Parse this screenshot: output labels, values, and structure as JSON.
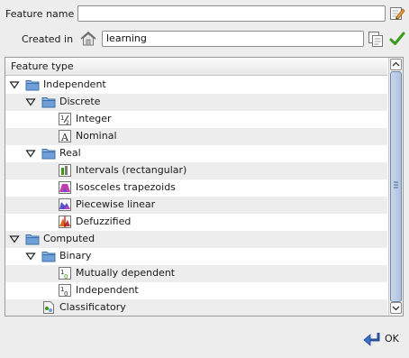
{
  "form": {
    "feature_name_label": "Feature name",
    "feature_name_value": "",
    "created_in_label": "Created in",
    "created_in_value": "learning"
  },
  "tree": {
    "column_header": "Feature type",
    "rows": [
      {
        "label": "Independent",
        "depth": 0,
        "expander": "expanded",
        "icon": "folder-icon"
      },
      {
        "label": "Discrete",
        "depth": 1,
        "expander": "expanded",
        "icon": "folder-icon"
      },
      {
        "label": "Integer",
        "depth": 2,
        "expander": "none",
        "icon": "integer-icon"
      },
      {
        "label": "Nominal",
        "depth": 2,
        "expander": "none",
        "icon": "nominal-icon"
      },
      {
        "label": "Real",
        "depth": 1,
        "expander": "expanded",
        "icon": "folder-icon"
      },
      {
        "label": "Intervals (rectangular)",
        "depth": 2,
        "expander": "none",
        "icon": "intervals-icon"
      },
      {
        "label": "Isosceles trapezoids",
        "depth": 2,
        "expander": "none",
        "icon": "trapezoid-icon"
      },
      {
        "label": "Piecewise linear",
        "depth": 2,
        "expander": "none",
        "icon": "piecewise-icon"
      },
      {
        "label": "Defuzzified",
        "depth": 2,
        "expander": "none",
        "icon": "defuzzified-icon"
      },
      {
        "label": "Computed",
        "depth": 0,
        "expander": "expanded",
        "icon": "folder-icon"
      },
      {
        "label": "Binary",
        "depth": 1,
        "expander": "expanded",
        "icon": "folder-icon"
      },
      {
        "label": "Mutually dependent",
        "depth": 2,
        "expander": "none",
        "icon": "binary-dependent-icon"
      },
      {
        "label": "Independent",
        "depth": 2,
        "expander": "none",
        "icon": "binary-independent-icon"
      },
      {
        "label": "Classificatory",
        "depth": 1,
        "expander": "none",
        "icon": "classificatory-icon"
      }
    ]
  },
  "ok_label": "OK",
  "colors": {
    "accent_green": "#3a9a1a",
    "folder_blue": "#6f9fd8",
    "selection_blue": "#aec3e0"
  }
}
